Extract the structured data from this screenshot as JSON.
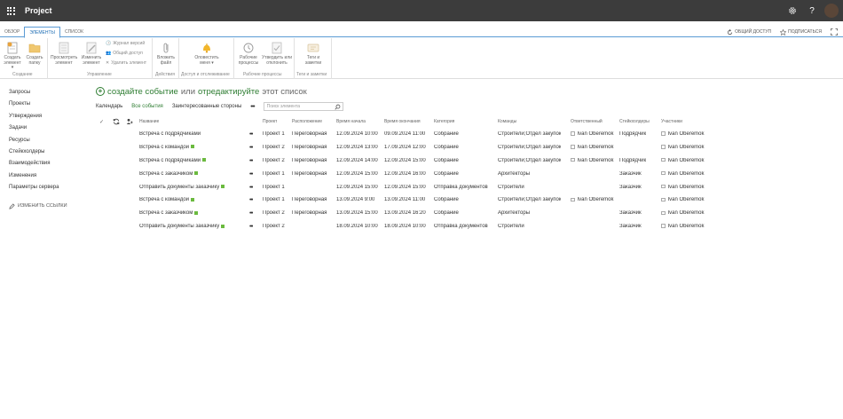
{
  "suitebar": {
    "app_title": "Project",
    "icons": [
      "waffle-icon",
      "gear-icon",
      "help-icon",
      "avatar"
    ]
  },
  "ribbon_tabs": [
    "ОБЗОР",
    "ЭЛЕМЕНТЫ",
    "СПИСОК"
  ],
  "ribbon_active_tab": "ЭЛЕМЕНТЫ",
  "ribbon_right": {
    "share": "ОБЩИЙ ДОСТУП",
    "follow": "ПОДПИСАТЬСЯ"
  },
  "ribbon": {
    "new_item": "Создать элемент",
    "new_folder": "Создать папку",
    "group_create": "Создание",
    "view_item": "Просмотреть элемент",
    "edit_item": "Изменить элемент",
    "version_history": "Журнал версий",
    "shared_with": "Общий доступ",
    "delete_item": "Удалить элемент",
    "group_manage": "Управление",
    "attach_file": "Вложить файл",
    "group_actions": "Действия",
    "alert_me": "Оповестить меня",
    "group_share": "Доступ и отслеживание",
    "workflows": "Рабочие процессы",
    "approve_reject": "Утвердить или отклонить",
    "group_workflows": "Рабочие процессы",
    "tags_notes": "Теги и заметки",
    "group_tags": "Теги и заметки"
  },
  "nav": {
    "items": [
      "Запросы",
      "Проекты",
      "Утверждения",
      "Задачи",
      "Ресурсы",
      "Стейкхолдеры",
      "Взаимодействия",
      "Изменения",
      "Параметры сервера"
    ],
    "edit_links": "ИЗМЕНИТЬ ССЫЛКИ"
  },
  "main": {
    "create_event": "создайте событие",
    "or": "или",
    "edit_list": "отредактируйте",
    "this_list": "этот список",
    "views": [
      "Календарь",
      "Все события",
      "Заинтересованные стороны"
    ],
    "selected_view": "Все события",
    "more": "•••",
    "search_placeholder": "Поиск элемента"
  },
  "table": {
    "columns": [
      "Название",
      "Проект",
      "Расположение",
      "Время начала",
      "Время окончания",
      "Категория",
      "Команды",
      "Ответственный",
      "Стейкхолдеры",
      "Участники"
    ],
    "rows": [
      {
        "title": "Встреча с подрядчиками",
        "new": false,
        "project": "Проект 1",
        "location": "Переговорная",
        "start": "12.09.2024 10:00",
        "end": "09.09.2024 11:00",
        "category": "Собрание",
        "teams": "Строители;Отдел закупок",
        "responsible": "Ivan Oberemok",
        "stakeholders": "Подрядчик",
        "participants": "Ivan Oberemok"
      },
      {
        "title": "Встреча с командой",
        "new": true,
        "project": "Проект 2",
        "location": "Переговорная",
        "start": "12.09.2024 13:00",
        "end": "17.09.2024 12:00",
        "category": "Собрание",
        "teams": "Строители;Отдел закупок",
        "responsible": "Ivan Oberemok",
        "stakeholders": "",
        "participants": "Ivan Oberemok"
      },
      {
        "title": "Встреча с подрядчиками",
        "new": true,
        "project": "Проект 2",
        "location": "Переговорная",
        "start": "12.09.2024 14:00",
        "end": "12.09.2024 15:00",
        "category": "Собрание",
        "teams": "Строители;Отдел закупок",
        "responsible": "Ivan Oberemok",
        "stakeholders": "Подрядчик",
        "participants": "Ivan Oberemok"
      },
      {
        "title": "Встреча с заказчиком",
        "new": true,
        "project": "Проект 1",
        "location": "Переговорная",
        "start": "12.09.2024 15:00",
        "end": "12.09.2024 16:00",
        "category": "Собрание",
        "teams": "Архитекторы",
        "responsible": "",
        "stakeholders": "Заказчик",
        "participants": "Ivan Oberemok"
      },
      {
        "title": "Отправить документы заказчику",
        "new": true,
        "project": "Проект 1",
        "location": "",
        "start": "12.09.2024 15:00",
        "end": "12.09.2024 15:00",
        "category": "Отправка документов",
        "teams": "Строители",
        "responsible": "",
        "stakeholders": "Заказчик",
        "participants": "Ivan Oberemok"
      },
      {
        "title": "Встреча с командой",
        "new": true,
        "project": "Проект 1",
        "location": "Переговорная",
        "start": "13.09.2024 9:00",
        "end": "13.09.2024 11:00",
        "category": "Собрание",
        "teams": "Строители;Отдел закупок",
        "responsible": "Ivan Oberemok",
        "stakeholders": "",
        "participants": "Ivan Oberemok"
      },
      {
        "title": "Встреча с заказчиком",
        "new": true,
        "project": "Проект 2",
        "location": "Переговорная",
        "start": "13.09.2024 15:00",
        "end": "13.09.2024 16:20",
        "category": "Собрание",
        "teams": "Архитекторы",
        "responsible": "",
        "stakeholders": "Заказчик",
        "participants": "Ivan Oberemok"
      },
      {
        "title": "Отправить документы заказчику",
        "new": true,
        "project": "Проект 2",
        "location": "",
        "start": "18.09.2024 10:00",
        "end": "18.09.2024 10:00",
        "category": "Отправка документов",
        "teams": "Строители",
        "responsible": "",
        "stakeholders": "Заказчик",
        "participants": "Ivan Oberemok"
      }
    ]
  },
  "colors": {
    "suitebar": "#3c3c3c",
    "accent_green": "#2e7d32",
    "ribbon_blue": "#5b9bd5",
    "new_badge": "#6bba3f"
  }
}
